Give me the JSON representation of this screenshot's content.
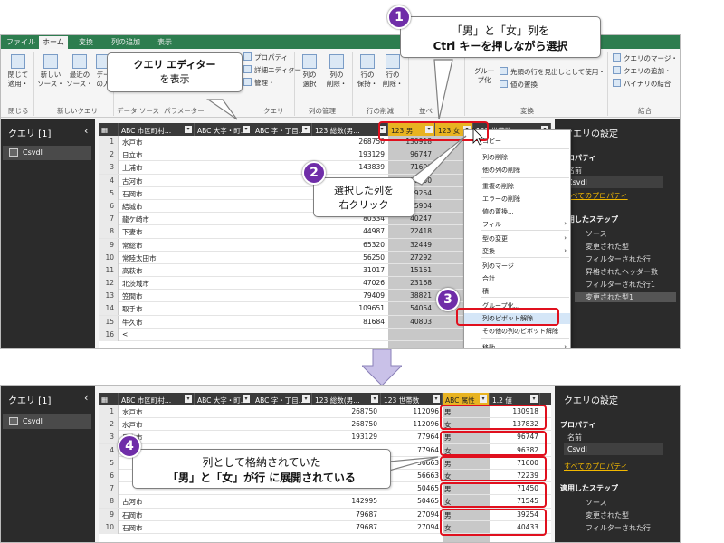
{
  "top_screen": {
    "tabs": [
      "ファイル",
      "ホーム",
      "変換",
      "列の追加",
      "表示"
    ],
    "ribbon": {
      "buttons": [
        {
          "label": "閉じて\n適用・"
        },
        {
          "label": "新しい\nソース・"
        },
        {
          "label": "最近の\nソース・"
        },
        {
          "label": "デー\nの入"
        },
        {
          "label": "列の\n選択"
        },
        {
          "label": "列の\n削除・"
        },
        {
          "label": "行の\n保持・"
        },
        {
          "label": "行の\n削除・"
        },
        {
          "label": "グルー\nプ化"
        }
      ],
      "small_items": [
        "プロパティ",
        "詳細エディター",
        "管理・",
        "先頭の行を見出しとして使用・",
        "値の置換",
        "クエリのマージ・",
        "クエリの追加・",
        "バイナリの結合"
      ],
      "groups": [
        "閉じる",
        "新しいクエリ",
        "データ ソース",
        "パラメーター",
        "クエリ",
        "列の管理",
        "行の削減",
        "並べ",
        "変換",
        "結合"
      ]
    },
    "queries": {
      "title": "クエリ [1]",
      "chevron": "‹",
      "item": "Csvdl"
    },
    "columns": [
      "市区町村…",
      "大字・町…",
      "字・丁目…",
      "総数(男…",
      "男",
      "女",
      "世帯数"
    ],
    "col_type_prefixes": [
      "ABC",
      "ABC",
      "ABC",
      "123",
      "123",
      "123",
      "123"
    ],
    "rows": [
      {
        "n": "1",
        "city": "水戸市",
        "total": "268750",
        "male": "130918"
      },
      {
        "n": "2",
        "city": "日立市",
        "total": "193129",
        "male": "96747"
      },
      {
        "n": "3",
        "city": "土浦市",
        "total": "143839",
        "male": "71600"
      },
      {
        "n": "4",
        "city": "古河市",
        "total": "142995",
        "male": "71450"
      },
      {
        "n": "5",
        "city": "石岡市",
        "total": "79687",
        "male": "39254"
      },
      {
        "n": "6",
        "city": "結城市",
        "total": "52047",
        "male": "25904"
      },
      {
        "n": "7",
        "city": "龍ケ崎市",
        "total": "80334",
        "male": "40247"
      },
      {
        "n": "8",
        "city": "下妻市",
        "total": "44987",
        "male": "22418"
      },
      {
        "n": "9",
        "city": "常総市",
        "total": "65320",
        "male": "32449"
      },
      {
        "n": "10",
        "city": "常陸太田市",
        "total": "56250",
        "male": "27292"
      },
      {
        "n": "11",
        "city": "高萩市",
        "total": "31017",
        "male": "15161"
      },
      {
        "n": "12",
        "city": "北茨城市",
        "total": "47026",
        "male": "23168"
      },
      {
        "n": "13",
        "city": "笠間市",
        "total": "79409",
        "male": "38821"
      },
      {
        "n": "14",
        "city": "取手市",
        "total": "109651",
        "male": "54054"
      },
      {
        "n": "15",
        "city": "牛久市",
        "total": "81684",
        "male": "40803"
      },
      {
        "n": "16",
        "city": "<",
        "total": "",
        "male": ""
      }
    ],
    "context_menu": [
      {
        "label": "コピー",
        "sub": false
      },
      {
        "label": "列の削除",
        "sub": false
      },
      {
        "label": "他の列の削除",
        "sub": false
      },
      {
        "label": "重複の削除",
        "sub": false
      },
      {
        "label": "エラーの削除",
        "sub": false
      },
      {
        "label": "値の置換...",
        "sub": false
      },
      {
        "label": "フィル",
        "sub": true
      },
      {
        "label": "型の変更",
        "sub": true
      },
      {
        "label": "変換",
        "sub": true
      },
      {
        "label": "列のマージ",
        "sub": false
      },
      {
        "label": "合計",
        "sub": false
      },
      {
        "label": "積",
        "sub": false
      },
      {
        "label": "グループ化...",
        "sub": false
      },
      {
        "label": "列のピボット解除",
        "sub": false
      },
      {
        "label": "その他の列のピボット解除",
        "sub": false
      },
      {
        "label": "移動",
        "sub": true
      }
    ],
    "settings": {
      "title": "クエリの設定",
      "prop_section": "プロパティ",
      "name_label": "名前",
      "name_value": "Csvdl",
      "all_props": "すべてのプロパティ",
      "steps_section": "適用したステップ",
      "steps": [
        "ソース",
        "変更された型",
        "フィルターされた行",
        "昇格されたヘッダー数",
        "フィルターされた行1",
        "変更された型1"
      ]
    }
  },
  "bottom_screen": {
    "queries": {
      "title": "クエリ [1]",
      "chevron": "‹",
      "item": "Csvdl"
    },
    "columns": [
      "市区町村…",
      "大字・町…",
      "字・丁目…",
      "総数(男…",
      "世帯数",
      "属性",
      "値"
    ],
    "col_type_prefixes": [
      "ABC",
      "ABC",
      "ABC",
      "123",
      "123",
      "ABC",
      "1.2"
    ],
    "rows": [
      {
        "n": "1",
        "city": "水戸市",
        "total": "268750",
        "hh": "112096",
        "attr": "男",
        "val": "130918"
      },
      {
        "n": "2",
        "city": "水戸市",
        "total": "268750",
        "hh": "112096",
        "attr": "女",
        "val": "137832"
      },
      {
        "n": "3",
        "city": "日立市",
        "total": "193129",
        "hh": "77964",
        "attr": "男",
        "val": "96747"
      },
      {
        "n": "4",
        "city": "",
        "total": "",
        "hh": "77964",
        "attr": "女",
        "val": "96382"
      },
      {
        "n": "5",
        "city": "",
        "total": "",
        "hh": "56663",
        "attr": "男",
        "val": "71600"
      },
      {
        "n": "6",
        "city": "",
        "total": "",
        "hh": "56663",
        "attr": "女",
        "val": "72239"
      },
      {
        "n": "7",
        "city": "",
        "total": "",
        "hh": "50465",
        "attr": "男",
        "val": "71450"
      },
      {
        "n": "8",
        "city": "古河市",
        "total": "142995",
        "hh": "50465",
        "attr": "女",
        "val": "71545"
      },
      {
        "n": "9",
        "city": "石岡市",
        "total": "79687",
        "hh": "27094",
        "attr": "男",
        "val": "39254"
      },
      {
        "n": "10",
        "city": "石岡市",
        "total": "79687",
        "hh": "27094",
        "attr": "女",
        "val": "40433"
      }
    ],
    "settings": {
      "title": "クエリの設定",
      "prop_section": "プロパティ",
      "name_label": "名前",
      "name_value": "Csvdl",
      "all_props": "すべてのプロパティ",
      "steps_section": "適用したステップ",
      "steps": [
        "ソース",
        "変更された型",
        "フィルターされた行"
      ]
    }
  },
  "callouts": {
    "c1_line1": "「男」と「女」列を",
    "c1_line2": "Ctrl キーを押しながら選択",
    "editor_line1": "クエリ エディター",
    "editor_line2": "を表示",
    "c2_line1": "選択した列を",
    "c2_line2": "右クリック",
    "c4_line1": "列として格納されていた",
    "c4_line2": "「男」と「女」が行 に展開されている"
  },
  "badges": [
    "1",
    "2",
    "3",
    "4"
  ],
  "colors": {
    "ribbon_green": "#2d7d4f",
    "selected_header": "#e8b321",
    "badge": "#6f2da8",
    "highlight_box": "#e0101e",
    "link": "#f2b800"
  }
}
